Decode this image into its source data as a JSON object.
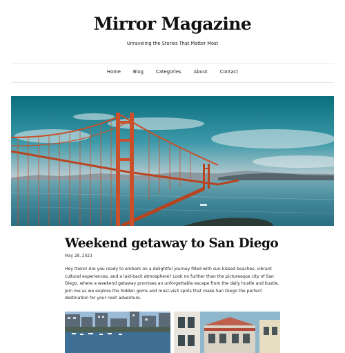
{
  "site": {
    "title": "Mirror Magazine",
    "tagline": "Unraveling the Stories That Matter Most"
  },
  "nav": {
    "items": [
      {
        "label": "Home"
      },
      {
        "label": "Blog"
      },
      {
        "label": "Categories"
      },
      {
        "label": "About"
      },
      {
        "label": "Contact"
      }
    ]
  },
  "post": {
    "title": "Weekend getaway to San Diego",
    "date": "May 28, 2023",
    "body": "Hey there! Are you ready to embark on a delightful journey filled with sun-kissed beaches, vibrant cultural experiences, and a laid-back atmosphere? Look no further than the picturesque city of San Diego, where a weekend getaway promises an unforgettable escape from the daily hustle and bustle. Join me as we explore the hidden gems and must-visit spots that make San Diego the perfect destination for your next adventure."
  },
  "colors": {
    "text": "#111111",
    "rule": "#e6e6e6",
    "bridge": "#c9502b",
    "water": "#4d8fa0",
    "sky_top": "#0e7e8c",
    "sky_horizon": "#f0a06a"
  },
  "images": {
    "hero": "golden-gate-bridge-photo",
    "thumb_left": "harbor-city-photo",
    "thumb_right": "victorian-houses-photo"
  }
}
